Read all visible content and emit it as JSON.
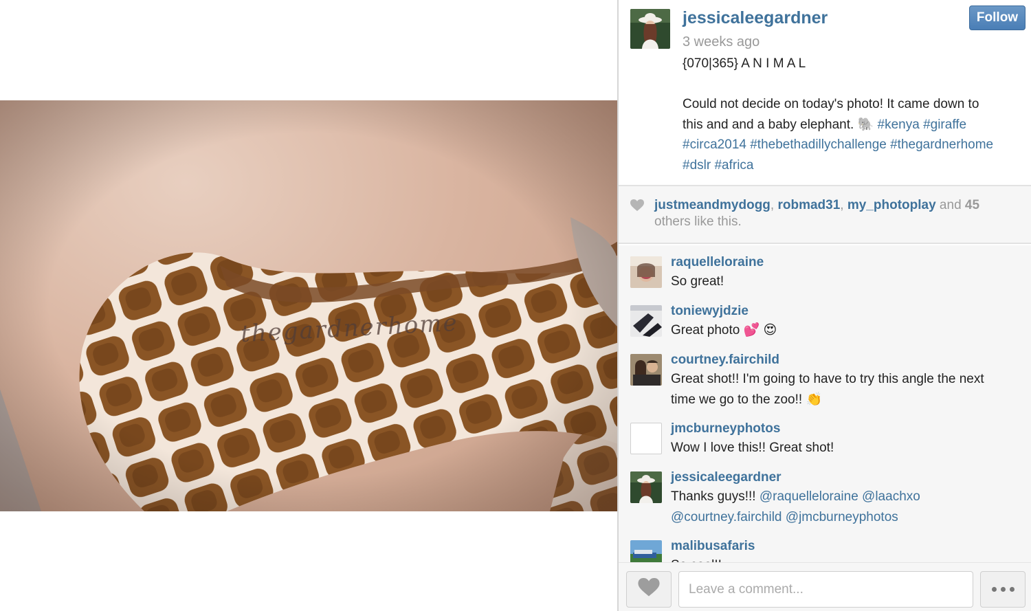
{
  "photo": {
    "watermark": "thegardnerhome"
  },
  "post": {
    "username": "jessicaleegardner",
    "time": "3 weeks ago",
    "follow_label": "Follow",
    "caption_title": "{070|365} A N I M A L",
    "caption_line1": "Could not decide on today's photo! It came down to",
    "caption_line2_text": "this and and a baby elephant. 🐘 ",
    "caption_line2_tags": "#kenya #giraffe",
    "caption_line3_tags": "#circa2014 #thebethadillychallenge #thegardnerhome",
    "caption_line4_tags": "#dslr #africa"
  },
  "likes": {
    "users": [
      "justmeandmydogg",
      "robmad31",
      "my_photoplay"
    ],
    "and_text": " and ",
    "count": "45",
    "suffix": "others like this."
  },
  "comments": [
    {
      "user": "raquelleloraine",
      "lines": [
        "So great!"
      ]
    },
    {
      "user": "toniewyjdzie",
      "lines": [
        "Great photo 💕 😍"
      ]
    },
    {
      "user": "courtney.fairchild",
      "lines": [
        "Great shot!! I'm going to have to try this angle the next",
        "time we go to the zoo!! 👏"
      ]
    },
    {
      "user": "jmcburneyphotos",
      "lines": [
        "Wow I love this!! Great shot!"
      ]
    },
    {
      "user": "jessicaleegardner",
      "line1_text": "Thanks guys!!! ",
      "line1_mentions": "@raquelleloraine @laachxo",
      "line2_mentions": "@courtney.fairchild @jmcburneyphotos"
    },
    {
      "user": "malibusafaris",
      "lines": [
        "So cool!!"
      ]
    }
  ],
  "composer": {
    "placeholder": "Leave a comment..."
  },
  "colors": {
    "link": "#3f729b",
    "follow_button": "#4a7eb6",
    "muted_text": "#999999"
  },
  "icons": [
    "heart-icon",
    "more-dots-icon"
  ]
}
